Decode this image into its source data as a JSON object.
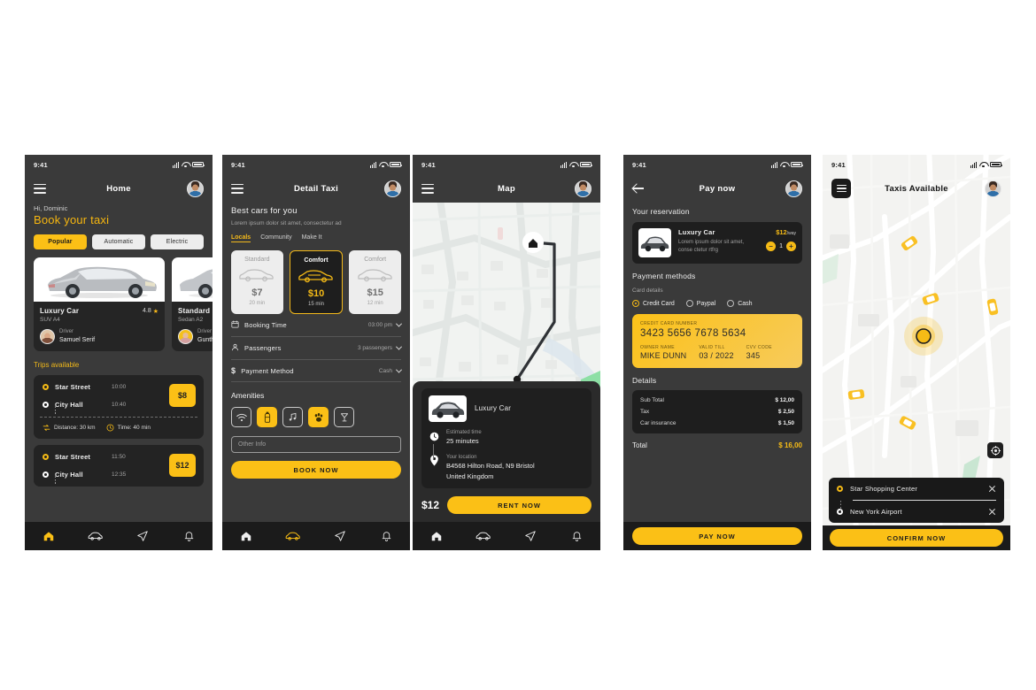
{
  "status_bar": {
    "time": "9:41"
  },
  "screen1": {
    "title": "Home",
    "greeting": "Hi, Dominic",
    "heading": "Book your taxi",
    "chips": [
      {
        "label": "Popular",
        "active": true
      },
      {
        "label": "Automatic",
        "active": false
      },
      {
        "label": "Electric",
        "active": false
      }
    ],
    "cars": [
      {
        "name": "Luxury Car",
        "rating": "4.8",
        "type": "SUV A4",
        "driver_label": "Driver",
        "driver_name": "Samuel Serif"
      },
      {
        "name": "Standard Car",
        "rating": "",
        "type": "Sedan A2",
        "driver_label": "Driver",
        "driver_name": "Gunther"
      }
    ],
    "trips_title": "Trips available",
    "trips": [
      {
        "from": "Star Street",
        "from_time": "10:00",
        "to": "City Hall",
        "to_time": "10:40",
        "price": "$8",
        "distance": "Distance: 30 km",
        "time": "Time: 40 min"
      },
      {
        "from": "Star Street",
        "from_time": "11:50",
        "to": "City Hall",
        "to_time": "12:35",
        "price": "$12",
        "distance": "",
        "time": ""
      }
    ],
    "nav": [
      "home-icon",
      "car-icon",
      "send-icon",
      "bell-icon"
    ]
  },
  "screen2": {
    "title": "Detail Taxi",
    "heading": "Best cars for you",
    "subtitle": "Lorem ipsum dolor sit amet, consectetur ad",
    "tabs": [
      {
        "label": "Locals",
        "active": true
      },
      {
        "label": "Community",
        "active": false
      },
      {
        "label": "Make It",
        "active": false
      }
    ],
    "options": [
      {
        "name": "Standard",
        "price": "$7",
        "time": "20 min",
        "selected": false
      },
      {
        "name": "Comfort",
        "price": "$10",
        "time": "15 min",
        "selected": true
      },
      {
        "name": "Comfort",
        "price": "$15",
        "time": "12 min",
        "selected": false
      }
    ],
    "rows": [
      {
        "icon": "calendar-icon",
        "label": "Booking Time",
        "value": "03:00 pm"
      },
      {
        "icon": "person-icon",
        "label": "Passengers",
        "value": "3 passengers"
      },
      {
        "icon": "dollar-icon",
        "label": "Payment Method",
        "value": "Cash"
      }
    ],
    "amenities_title": "Amenities",
    "amenities": [
      {
        "icon": "wifi-icon",
        "active": false
      },
      {
        "icon": "water-bottle-icon",
        "active": true
      },
      {
        "icon": "music-icon",
        "active": false
      },
      {
        "icon": "paw-icon",
        "active": true
      },
      {
        "icon": "drink-icon",
        "active": false
      }
    ],
    "other_info_placeholder": "Other Info",
    "book_button": "BOOK NOW"
  },
  "screen3": {
    "title": "Map",
    "car_name": "Luxury Car",
    "estimated_time_label": "Estimated time",
    "estimated_time_value": "25 minutes",
    "location_label": "Your location",
    "location_value_1": "B4568 Hilton Road, N9 Bristol",
    "location_value_2": "United Kingdom",
    "price": "$12",
    "rent_button": "RENT NOW",
    "markers": {
      "home": "home-marker",
      "car": "car-marker"
    }
  },
  "screen4": {
    "title": "Pay now",
    "reservation_title": "Your reservation",
    "reservation": {
      "car_name": "Luxury Car",
      "description": "Lorem ipsum dolor sit amet, conse ctetur  rtfrg",
      "price": "$12",
      "price_suffix": "/way",
      "quantity": "1",
      "minus": "–",
      "plus": "+"
    },
    "payment_methods_title": "Payment methods",
    "card_details_label": "Card details",
    "payment_options": [
      {
        "label": "Credit Card",
        "selected": true
      },
      {
        "label": "Paypal",
        "selected": false
      },
      {
        "label": "Cash",
        "selected": false
      }
    ],
    "card": {
      "number_label": "CREDIT CARD NUMBER",
      "number": "3423 5656 7678 5634",
      "owner_label": "OWNER NAME",
      "owner": "MIKE DUNN",
      "valid_label": "VALID TILL",
      "valid": "03 / 2022",
      "cvv_label": "CVV CODE",
      "cvv": "345"
    },
    "details_title": "Details",
    "details": [
      {
        "label": "Sub Total",
        "value": "$ 12,00"
      },
      {
        "label": "Tax",
        "value": "$ 2,50"
      },
      {
        "label": "Car insurance",
        "value": "$ 1,50"
      }
    ],
    "total_label": "Total",
    "total_value": "$ 16,00",
    "pay_button": "PAY NOW"
  },
  "screen5": {
    "title": "Taxis Available",
    "destinations": [
      {
        "name": "Star Shopping Center",
        "type": "origin"
      },
      {
        "name": "New York Airport",
        "type": "destination"
      }
    ],
    "confirm_button": "CONFIRM NOW",
    "locate_icon": "crosshair-icon"
  },
  "colors": {
    "accent": "#fbc016",
    "accent_text": "#f6bb16",
    "dark_bg": "#3a3a3a",
    "card_bg": "#1e1e1e",
    "nav_bg": "#1b1b1b"
  }
}
